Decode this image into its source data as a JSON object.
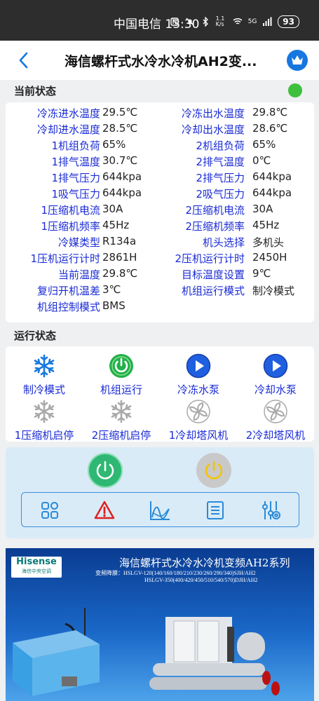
{
  "statusbar": {
    "carrier_time": "中国电信 13:30",
    "net_speed": "1.1 K/s",
    "signal": "5G",
    "battery": "93"
  },
  "nav": {
    "title": "海信螺杆式水冷水冷机AH2变..."
  },
  "current_status": {
    "title": "当前状态",
    "indicator_color": "#3dc03d",
    "rows": [
      [
        {
          "label": "冷冻进水温度",
          "value": "29.5℃"
        },
        {
          "label": "冷冻出水温度",
          "value": "29.8℃"
        }
      ],
      [
        {
          "label": "冷却进水温度",
          "value": "28.5℃"
        },
        {
          "label": "冷却出水温度",
          "value": "28.6℃"
        }
      ],
      [
        {
          "label": "1机组负荷",
          "value": "65%"
        },
        {
          "label": "2机组负荷",
          "value": "65%"
        }
      ],
      [
        {
          "label": "1排气温度",
          "value": "30.7℃"
        },
        {
          "label": "2排气温度",
          "value": "0℃"
        }
      ],
      [
        {
          "label": "1排气压力",
          "value": "644kpa"
        },
        {
          "label": "2排气压力",
          "value": "644kpa"
        }
      ],
      [
        {
          "label": "1吸气压力",
          "value": "644kpa"
        },
        {
          "label": "2吸气压力",
          "value": "644kpa"
        }
      ],
      [
        {
          "label": "1压缩机电流",
          "value": "30A"
        },
        {
          "label": "2压缩机电流",
          "value": "30A"
        }
      ],
      [
        {
          "label": "1压缩机频率",
          "value": "45Hz"
        },
        {
          "label": "2压缩机频率",
          "value": "45Hz"
        }
      ],
      [
        {
          "label": "冷媒类型",
          "value": "R134a"
        },
        {
          "label": "机头选择",
          "value": "多机头"
        }
      ],
      [
        {
          "label": "1压机运行计时",
          "value": "2861H"
        },
        {
          "label": "2压机运行计时",
          "value": "2450H"
        }
      ],
      [
        {
          "label": "当前温度",
          "value": "29.8℃"
        },
        {
          "label": "目标温度设置",
          "value": "9℃"
        }
      ],
      [
        {
          "label": "复归开机温差",
          "value": "3℃"
        },
        {
          "label": "机组运行模式",
          "value": "制冷模式"
        }
      ],
      [
        {
          "label": "机组控制模式",
          "value": "BMS"
        }
      ]
    ]
  },
  "run_status": {
    "title": "运行状态",
    "items": [
      {
        "label": "制冷模式",
        "icon": "snowflake-icon",
        "active": true
      },
      {
        "label": "机组运行",
        "icon": "power-icon",
        "active": true
      },
      {
        "label": "冷冻水泵",
        "icon": "play-icon",
        "active": true
      },
      {
        "label": "冷却水泵",
        "icon": "play-icon",
        "active": true
      },
      {
        "label": "1压缩机启停",
        "icon": "snowflake-icon",
        "active": false
      },
      {
        "label": "2压缩机启停",
        "icon": "snowflake-icon",
        "active": false
      },
      {
        "label": "1冷却塔风机",
        "icon": "fan-icon",
        "active": false
      },
      {
        "label": "2冷却塔风机",
        "icon": "fan-icon",
        "active": false
      }
    ]
  },
  "controls": {
    "power_on_color": "#2fb873",
    "power_off_color": "#c9c9c9",
    "tools": [
      "grid-icon",
      "alarm-icon",
      "curve-icon",
      "list-icon",
      "settings-sliders-icon"
    ]
  },
  "ad": {
    "logo_brand": "Hisense",
    "logo_sub": "海信中央空调",
    "title": "海信螺杆式水冷水冷机变频AH2系列",
    "spec_line1": "变频降膜：HSLGV-120(140/160/180/210/230/260/290/340)SJH/AH2",
    "spec_line2": "HSLGV-350(400/420/450/510/540/570)DJH/AH2"
  }
}
